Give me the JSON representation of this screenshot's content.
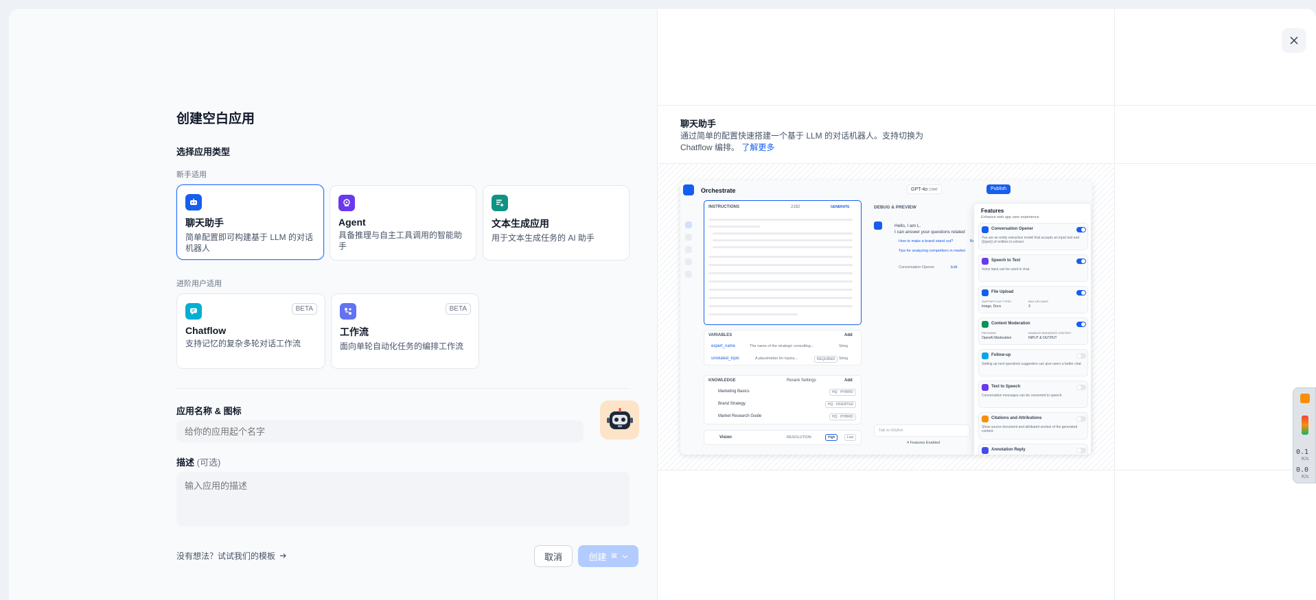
{
  "left": {
    "title": "创建空白应用",
    "section_type": "选择应用类型",
    "beginner_label": "新手适用",
    "advanced_label": "进阶用户适用",
    "cards_beginner": [
      {
        "title": "聊天助手",
        "desc": "简单配置即可构建基于 LLM 的对话机器人",
        "color": "#155eef",
        "selected": true
      },
      {
        "title": "Agent",
        "desc": "具备推理与自主工具调用的智能助手",
        "color": "#6938ef"
      },
      {
        "title": "文本生成应用",
        "desc": "用于文本生成任务的 AI 助手",
        "color": "#0e9384"
      }
    ],
    "cards_advanced": [
      {
        "title": "Chatflow",
        "desc": "支持记忆的复杂多轮对话工作流",
        "badge": "BETA",
        "color": "#06aed4"
      },
      {
        "title": "工作流",
        "desc": "面向单轮自动化任务的编排工作流",
        "badge": "BETA",
        "color": "#6172f3"
      }
    ],
    "name_label": "应用名称 & 图标",
    "name_placeholder": "给你的应用起个名字",
    "desc_label": "描述",
    "desc_optional": "(可选)",
    "desc_placeholder": "输入应用的描述",
    "template_link": "没有想法？试试我们的模板",
    "cancel": "取消",
    "create": "创建"
  },
  "right": {
    "title": "聊天助手",
    "desc": "通过简单的配置快速搭建一个基于 LLM 的对话机器人。支持切换为 Chatflow 编排。",
    "learn_more": "了解更多"
  },
  "preview": {
    "app_title": "Orchestrate",
    "model": "GPT-4o",
    "model_tag": "CHAT",
    "publish": "Publish",
    "instructions": "INSTRUCTIONS",
    "instr_count": "2182",
    "generate": "GENERATE",
    "debug": "DEBUG & PREVIEW",
    "chat_greet1": "Hello, I am L.",
    "chat_greet2": "I can answer your questions related",
    "suggest1": "How to make a brand stand out?",
    "suggest1b": "Bes",
    "suggest2": "Tips for analyzing competitors in market",
    "conv_opener": "Conversation Opener",
    "edit": "Edit",
    "variables": "VARIABLES",
    "add": "Add",
    "var1_name": "expert_name",
    "var1_desc": "The name of the strategic consulting...",
    "var1_type": "String",
    "var2_name": "unrelated_topic",
    "var2_desc": "A placeholder for topica...",
    "var2_req": "REQUIRED",
    "var2_type": "String",
    "knowledge": "KNOWLEDGE",
    "rerank": "Rerank Settings",
    "kb": [
      {
        "name": "Marketing Basics",
        "tag": "HQ · HYBRID"
      },
      {
        "name": "Brand Strategy",
        "tag": "HQ · INVERTED"
      },
      {
        "name": "Market Research Guide",
        "tag": "HQ · HYBRID"
      }
    ],
    "vision": "Vision",
    "resolution": "RESOLUTION",
    "high": "High",
    "low": "Low",
    "talk_placeholder": "Talk to DifyBot",
    "features_enabled": "4 Features Enabled",
    "features_title": "Features",
    "features_sub": "Enhance web app user experience",
    "features": [
      {
        "name": "Conversation Opener",
        "desc": "You are an entity extraction model that accepts an input text and {{type}} of entities to extract.",
        "on": true,
        "color": "#155eef"
      },
      {
        "name": "Speech to Text",
        "desc": "Voice input can be used in chat.",
        "on": true,
        "color": "#6938ef"
      },
      {
        "name": "File Upload",
        "k1": "SUPPORT FILE TYPES",
        "v1": "Image, Docs",
        "k2": "MAX UPLOADS",
        "v2": "3",
        "on": true,
        "color": "#155eef"
      },
      {
        "name": "Content Moderation",
        "k1": "PROVIDER",
        "v1": "OpenAI Moderation",
        "k2": "ENABLED MODERATE CONTENT",
        "v2": "INPUT & OUTPUT",
        "on": true,
        "color": "#079455"
      },
      {
        "name": "Follow-up",
        "desc": "Setting up next questions suggestion can give users a better chat.",
        "on": false,
        "color": "#0ba5ec"
      },
      {
        "name": "Text to Speech",
        "desc": "Conversation messages can be converted to speech.",
        "on": false,
        "color": "#6938ef"
      },
      {
        "name": "Citations and Attributions",
        "desc": "Show source document and attributed section of the generated content.",
        "on": false,
        "color": "#f79009"
      },
      {
        "name": "Annotation Reply",
        "on": false,
        "color": "#444ce7"
      }
    ]
  },
  "widget": {
    "up": "0.1",
    "up_unit": "K/s",
    "down": "0.0",
    "down_unit": "K/s"
  }
}
